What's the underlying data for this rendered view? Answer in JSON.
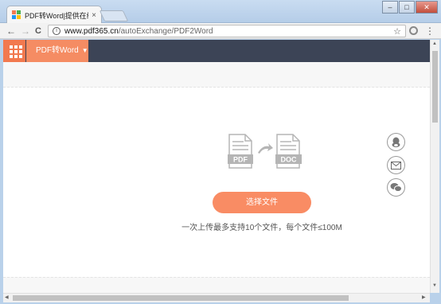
{
  "browser": {
    "tab_title": "PDF转Word|提供在线PDF",
    "tab_close": "×",
    "back": "←",
    "forward": "→",
    "reload": "C",
    "info": "i",
    "url_host": "www.pdf365.cn",
    "url_path": "/autoExchange/PDF2Word",
    "star": "☆",
    "menu": "⋮",
    "win_min": "–",
    "win_max": "□",
    "win_close": "✕"
  },
  "site": {
    "menu_label": "PDF转Word",
    "menu_caret": "▼"
  },
  "converter": {
    "source_label": "PDF",
    "target_label": "DOC",
    "upload_button": "选择文件",
    "hint": "一次上传最多支持10个文件，每个文件≤100M"
  },
  "colors": {
    "accent": "#f98c64",
    "header_bg": "#3c4456",
    "icon_gray": "#b5b5b5"
  },
  "icons": [
    "apps-grid-icon",
    "pdf-file-icon",
    "arrow-right-icon",
    "doc-file-icon",
    "qq-icon",
    "email-icon",
    "wechat-icon"
  ]
}
